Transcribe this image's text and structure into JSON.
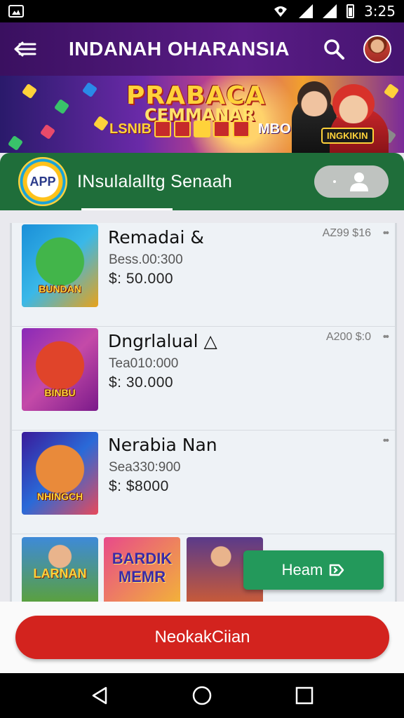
{
  "status_bar": {
    "time": "3:25"
  },
  "app_bar": {
    "title": "INDANAH OHARANSIA"
  },
  "banner": {
    "title": "PRABACA",
    "subtitle": "CEMMANAR",
    "strip_label_left": "LSNIB",
    "strip_label_right": "MBO",
    "badge": "INGKIKIN"
  },
  "green_card": {
    "logo_text": "APP",
    "text": "INsulalalltg Senaah"
  },
  "games": [
    {
      "thumb_label": "BUNDAN",
      "title": "Remadai",
      "title_icon": "&",
      "sub": "Bess.00:300",
      "price": "$: 50.000",
      "meta": "AZ99 $16",
      "more": "••"
    },
    {
      "thumb_label": "BINBU",
      "title": "Dngrlalual",
      "title_icon": "△",
      "sub": "Tea010:000",
      "price": "$: 30.000",
      "meta": "A200 $:0",
      "more": "••"
    },
    {
      "thumb_label": "NHINGCH",
      "title": "Nerabia Nan",
      "title_icon": "",
      "sub": "Sea330:900",
      "price": "$: $8000",
      "meta": "",
      "more": "••"
    }
  ],
  "bottom_tiles": [
    {
      "label": "LARNAN"
    },
    {
      "label": "BARDIK MEMR"
    },
    {
      "label": ""
    }
  ],
  "fab": {
    "label": "Heam"
  },
  "cta": {
    "label": "NeokakCiian"
  }
}
